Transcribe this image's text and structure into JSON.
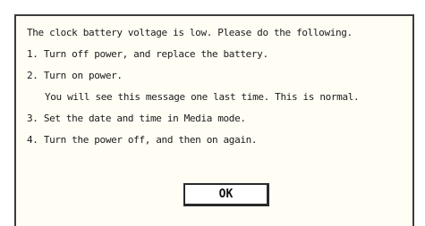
{
  "dialog": {
    "lines": [
      "The clock battery voltage is low. Please do the following.",
      "1. Turn off power, and replace the battery.",
      "2. Turn on power.",
      "You will see this message one last time. This is normal.",
      "3. Set the date and time in Media mode.",
      "4. Turn the power off, and then on again."
    ],
    "ok_label": "OK"
  }
}
